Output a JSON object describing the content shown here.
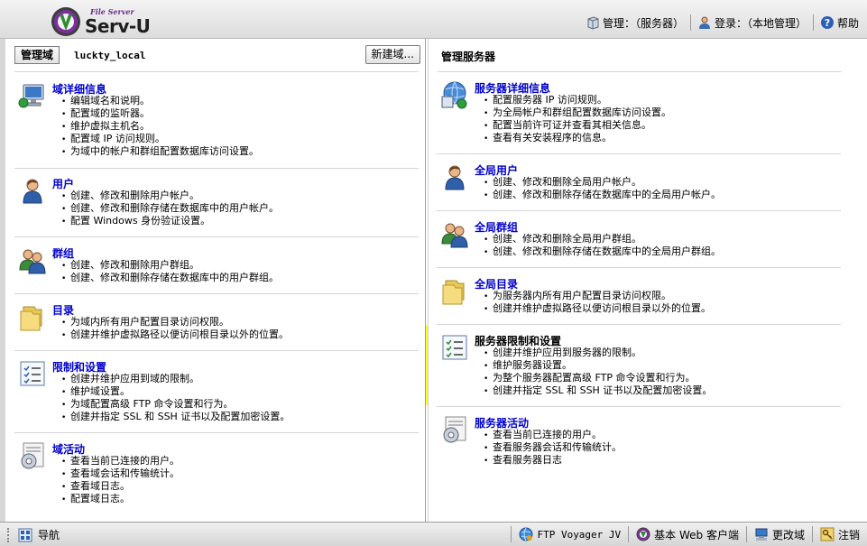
{
  "header": {
    "logo_subtitle": "File Server",
    "logo_name": "Serv-U",
    "manage_label": "管理：（服务器）",
    "login_label": "登录：（本地管理）",
    "help_label": "帮助"
  },
  "domain_bar": {
    "label": "管理域",
    "domain_name": "luckty_local",
    "new_domain_button": "新建域..."
  },
  "left_sections": [
    {
      "title": "域详细信息",
      "items": [
        "编辑域名和说明。",
        "配置域的监听器。",
        "维护虚拟主机名。",
        "配置域 IP 访问规则。",
        "为域中的帐户和群组配置数据库访问设置。"
      ]
    },
    {
      "title": "用户",
      "items": [
        "创建、修改和删除用户帐户。",
        "创建、修改和删除存储在数据库中的用户帐户。",
        "配置 Windows 身份验证设置。"
      ]
    },
    {
      "title": "群组",
      "items": [
        "创建、修改和删除用户群组。",
        "创建、修改和删除存储在数据库中的用户群组。"
      ]
    },
    {
      "title": "目录",
      "items": [
        "为域内所有用户配置目录访问权限。",
        "创建并维护虚拟路径以便访问根目录以外的位置。"
      ]
    },
    {
      "title": "限制和设置",
      "items": [
        "创建并维护应用到域的限制。",
        "维护域设置。",
        "为域配置高级 FTP 命令设置和行为。",
        "创建并指定 SSL 和 SSH 证书以及配置加密设置。"
      ]
    },
    {
      "title": "域活动",
      "items": [
        "查看当前已连接的用户。",
        "查看域会话和传输统计。",
        "查看域日志。",
        "配置域日志。"
      ]
    }
  ],
  "right_title": "管理服务器",
  "right_sections": [
    {
      "title": "服务器详细信息",
      "items": [
        "配置服务器 IP 访问规则。",
        "为全局帐户和群组配置数据库访问设置。",
        "配置当前许可证并查看其相关信息。",
        "查看有关安装程序的信息。"
      ]
    },
    {
      "title": "全局用户",
      "items": [
        "创建、修改和删除全局用户帐户。",
        "创建、修改和删除存储在数据库中的全局用户帐户。"
      ]
    },
    {
      "title": "全局群组",
      "items": [
        "创建、修改和删除全局用户群组。",
        "创建、修改和删除存储在数据库中的全局用户群组。"
      ]
    },
    {
      "title": "全局目录",
      "items": [
        "为服务器内所有用户配置目录访问权限。",
        "创建并维护虚拟路径以便访问根目录以外的位置。"
      ]
    },
    {
      "title": "服务器限制和设置",
      "items": [
        "创建并维护应用到服务器的限制。",
        "维护服务器设置。",
        "为整个服务器配置高级 FTP 命令设置和行为。",
        "创建并指定 SSL 和 SSH 证书以及配置加密设置。"
      ]
    },
    {
      "title": "服务器活动",
      "items": [
        "查看当前已连接的用户。",
        "查看服务器会话和传输统计。",
        "查看服务器日志"
      ]
    }
  ],
  "statusbar": {
    "nav_label": "导航",
    "ftp_voyager": "FTP Voyager JV",
    "web_client": "基本 Web 客户端",
    "change_domain": "更改域",
    "logout": "注销"
  },
  "colors": {
    "link": "#0000cc",
    "highlight": "#fdfd20"
  }
}
